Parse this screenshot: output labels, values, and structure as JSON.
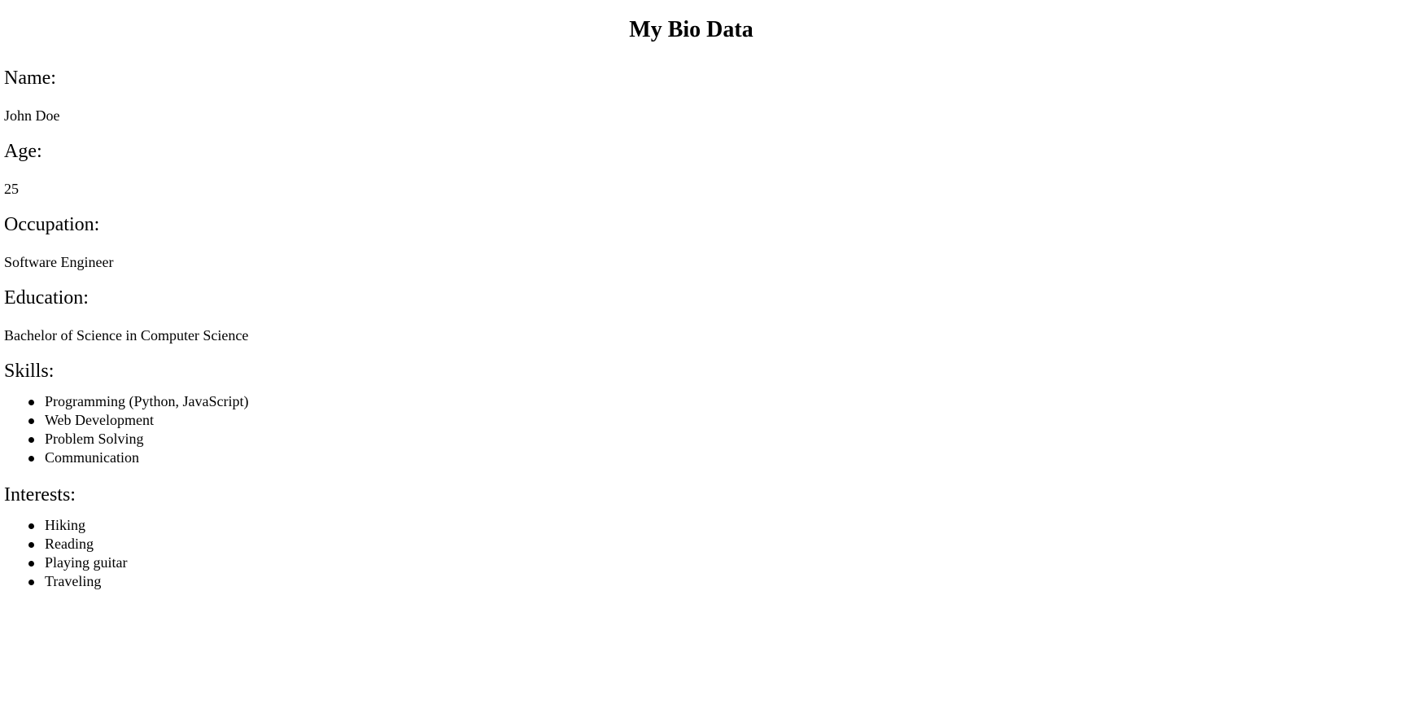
{
  "header": {
    "title": "My Bio Data"
  },
  "sections": {
    "name": {
      "label": "Name:",
      "value": "John Doe"
    },
    "age": {
      "label": "Age:",
      "value": "25"
    },
    "occupation": {
      "label": "Occupation:",
      "value": "Software Engineer"
    },
    "education": {
      "label": "Education:",
      "value": "Bachelor of Science in Computer Science"
    },
    "skills": {
      "label": "Skills:",
      "items": [
        "Programming (Python, JavaScript)",
        "Web Development",
        "Problem Solving",
        "Communication"
      ]
    },
    "interests": {
      "label": "Interests:",
      "items": [
        "Hiking",
        "Reading",
        "Playing guitar",
        "Traveling"
      ]
    }
  }
}
